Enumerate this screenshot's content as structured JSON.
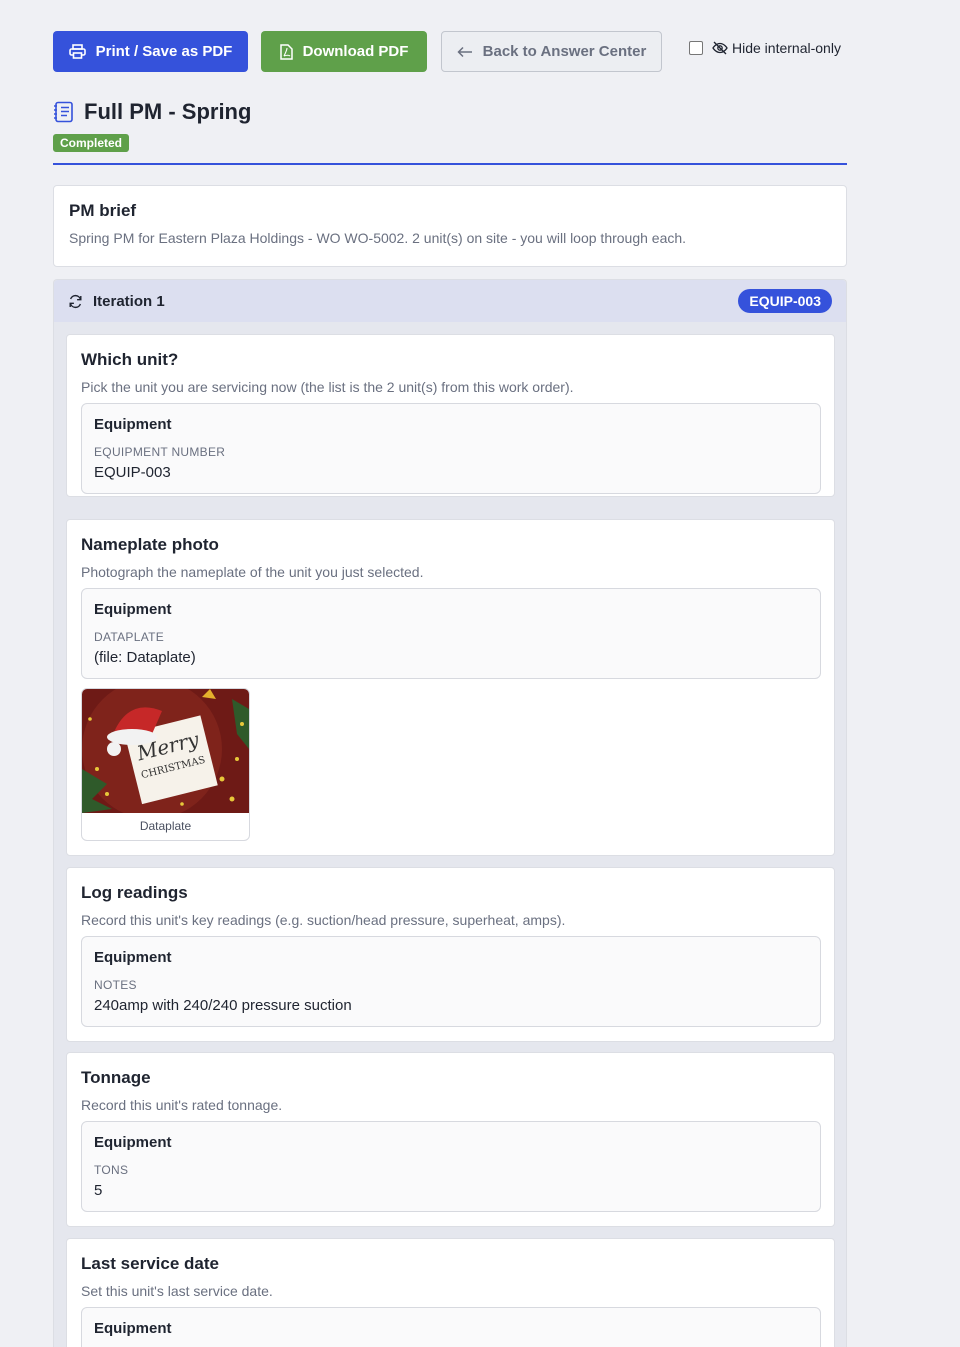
{
  "toolbar": {
    "print_label": "Print / Save as PDF",
    "download_label": "Download PDF",
    "back_label": "Back to Answer Center",
    "hide_internal_label": "Hide internal-only"
  },
  "colors": {
    "primary": "#3552db",
    "success": "#5fa04a",
    "muted": "#6a7080"
  },
  "header": {
    "title": "Full PM - Spring",
    "status": "Completed"
  },
  "brief": {
    "title": "PM brief",
    "text": "Spring PM for Eastern Plaza Holdings - WO WO-5002. 2 unit(s) on site - you will loop through each."
  },
  "iteration": {
    "label": "Iteration 1",
    "badge": "EQUIP-003",
    "steps": [
      {
        "title": "Which unit?",
        "desc": "Pick the unit you are servicing now (the list is the 2 unit(s) from this work order).",
        "group": "Equipment",
        "key": "EQUIPMENT NUMBER",
        "value": "EQUIP-003"
      },
      {
        "title": "Nameplate photo",
        "desc": "Photograph the nameplate of the unit you just selected.",
        "group": "Equipment",
        "key": "DATAPLATE",
        "value": "(file: Dataplate)",
        "photo_caption": "Dataplate",
        "photo_text_1": "Merry",
        "photo_text_2": "CHRISTMAS"
      },
      {
        "title": "Log readings",
        "desc": "Record this unit's key readings (e.g. suction/head pressure, superheat, amps).",
        "group": "Equipment",
        "key": "NOTES",
        "value": "240amp with 240/240 pressure suction"
      },
      {
        "title": "Tonnage",
        "desc": "Record this unit's rated tonnage.",
        "group": "Equipment",
        "key": "TONS",
        "value": "5"
      },
      {
        "title": "Last service date",
        "desc": "Set this unit's last service date.",
        "group": "Equipment"
      }
    ]
  }
}
